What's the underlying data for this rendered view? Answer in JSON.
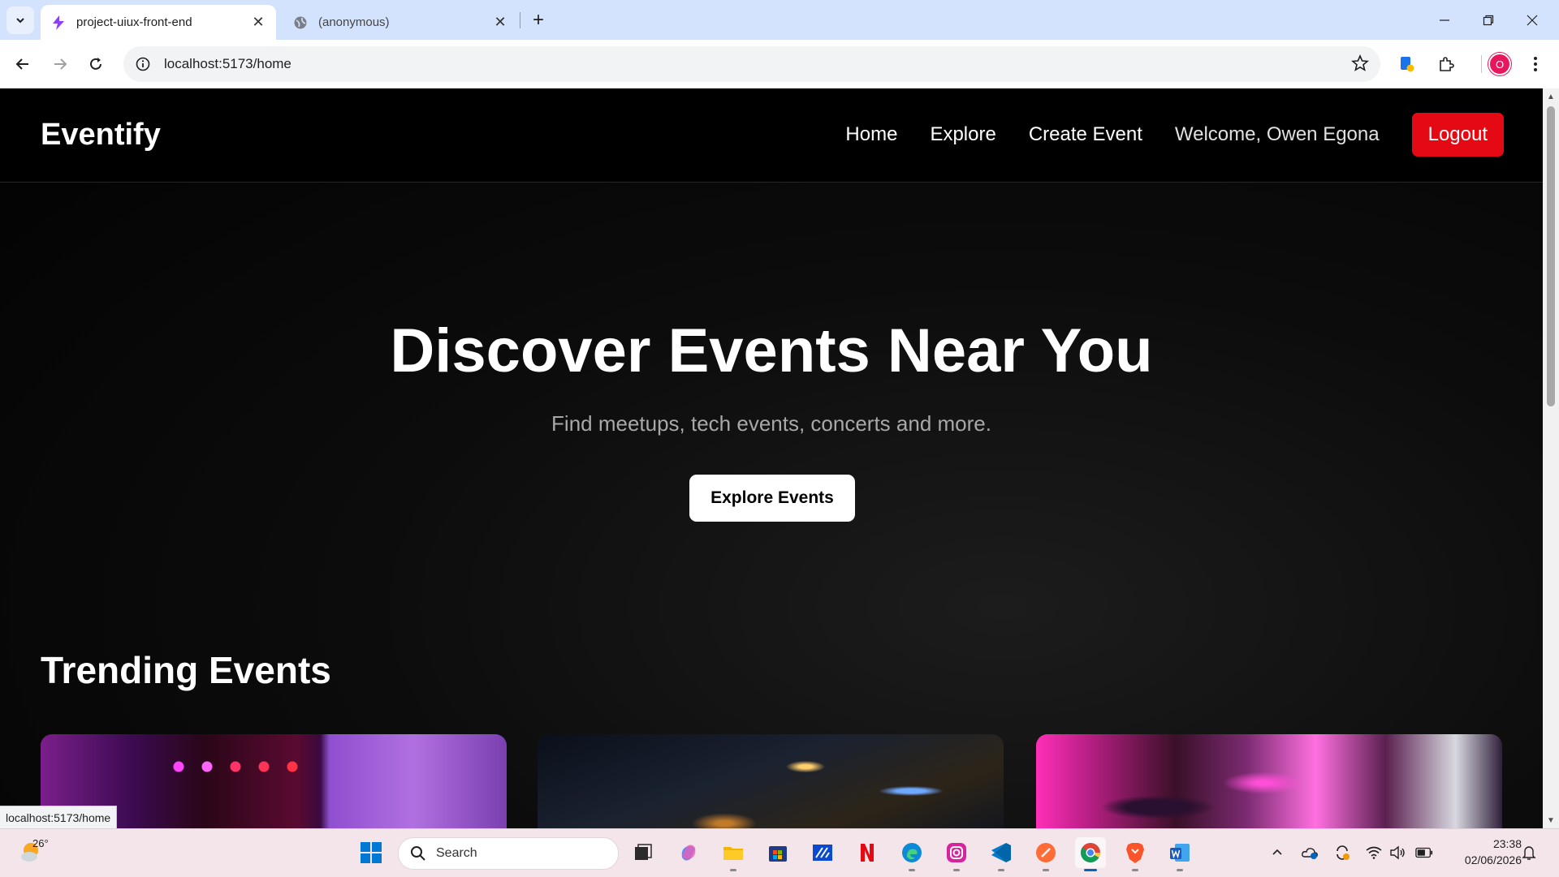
{
  "browser": {
    "tabs": [
      {
        "title": "project-uiux-front-end",
        "active": true
      },
      {
        "title": "(anonymous)",
        "active": false
      }
    ],
    "url": "localhost:5173/home",
    "profile_initial": "O",
    "status_url": "localhost:5173/home"
  },
  "site": {
    "logo": "Eventify",
    "nav": {
      "home": "Home",
      "explore": "Explore",
      "create_event": "Create Event",
      "welcome": "Welcome, Owen Egona",
      "logout": "Logout"
    },
    "hero": {
      "title": "Discover Events Near You",
      "subtitle": "Find meetups, tech events, concerts and more.",
      "cta": "Explore Events"
    },
    "trending": {
      "title": "Trending Events"
    }
  },
  "colors": {
    "accent_red": "#e50914",
    "page_bg": "#000000",
    "tabstrip_bg": "#d3e3fd"
  },
  "taskbar": {
    "weather_temp": "26°",
    "search_label": "Search",
    "time": "23:38",
    "date": "02/06/2026",
    "apps": [
      "start-icon",
      "task-view-icon",
      "copilot-icon",
      "file-explorer-icon",
      "store-icon",
      "ide-icon",
      "netflix-icon",
      "edge-icon",
      "instagram-icon",
      "vscode-icon",
      "postman-icon",
      "chrome-icon",
      "brave-icon",
      "word-icon"
    ]
  }
}
